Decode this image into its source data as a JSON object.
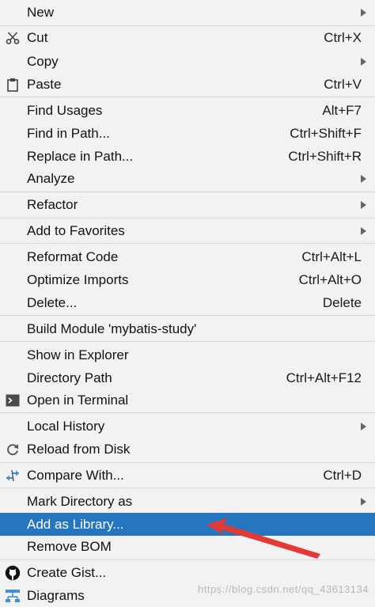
{
  "menu": {
    "new": {
      "label": "New"
    },
    "cut": {
      "label": "Cut",
      "shortcut": "Ctrl+X",
      "icon": "scissors-icon"
    },
    "copy": {
      "label": "Copy"
    },
    "paste": {
      "label": "Paste",
      "shortcut": "Ctrl+V",
      "icon": "clipboard-icon"
    },
    "find_usages": {
      "label": "Find Usages",
      "shortcut": "Alt+F7"
    },
    "find_in_path": {
      "label": "Find in Path...",
      "shortcut": "Ctrl+Shift+F"
    },
    "replace_in_path": {
      "label": "Replace in Path...",
      "shortcut": "Ctrl+Shift+R"
    },
    "analyze": {
      "label": "Analyze"
    },
    "refactor": {
      "label": "Refactor"
    },
    "add_to_favorites": {
      "label": "Add to Favorites"
    },
    "reformat_code": {
      "label": "Reformat Code",
      "shortcut": "Ctrl+Alt+L"
    },
    "optimize_imports": {
      "label": "Optimize Imports",
      "shortcut": "Ctrl+Alt+O"
    },
    "delete": {
      "label": "Delete...",
      "shortcut": "Delete"
    },
    "build_module": {
      "label": "Build Module 'mybatis-study'"
    },
    "show_in_explorer": {
      "label": "Show in Explorer"
    },
    "directory_path": {
      "label": "Directory Path",
      "shortcut": "Ctrl+Alt+F12"
    },
    "open_in_terminal": {
      "label": "Open in Terminal",
      "icon": "terminal-icon"
    },
    "local_history": {
      "label": "Local History"
    },
    "reload_from_disk": {
      "label": "Reload from Disk",
      "icon": "reload-icon"
    },
    "compare_with": {
      "label": "Compare With...",
      "shortcut": "Ctrl+D",
      "icon": "compare-icon"
    },
    "mark_directory_as": {
      "label": "Mark Directory as"
    },
    "add_as_library": {
      "label": "Add as Library..."
    },
    "remove_bom": {
      "label": "Remove BOM"
    },
    "create_gist": {
      "label": "Create Gist...",
      "icon": "github-icon"
    },
    "diagrams": {
      "label": "Diagrams",
      "icon": "diagram-icon"
    }
  },
  "colors": {
    "menu_background": "#f2f2f2",
    "selected_background": "#2675bf",
    "selected_text": "#ffffff",
    "separator": "#d6d6d6",
    "annotation_arrow": "#e53935"
  },
  "watermark": {
    "text": "https://blog.csdn.net/qq_43613134"
  }
}
